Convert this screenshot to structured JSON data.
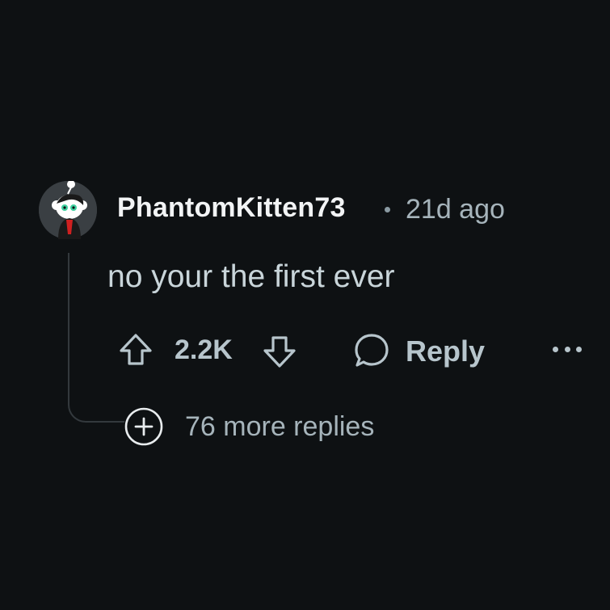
{
  "comment": {
    "username": "PhantomKitten73",
    "separator": "·",
    "timestamp": "21d ago",
    "body": "no your the first ever",
    "score": "2.2K",
    "reply_label": "Reply",
    "more_replies_label": "76 more replies"
  },
  "icons": {
    "avatar": "user-avatar",
    "upvote": "upvote-arrow-icon",
    "downvote": "downvote-arrow-icon",
    "reply": "speech-bubble-icon",
    "more": "ellipsis-icon",
    "expand": "plus-circle-icon"
  },
  "colors": {
    "background": "#0e1113",
    "username": "#f2f4f5",
    "meta": "#a6b4bb",
    "thread_line": "#33393d"
  }
}
